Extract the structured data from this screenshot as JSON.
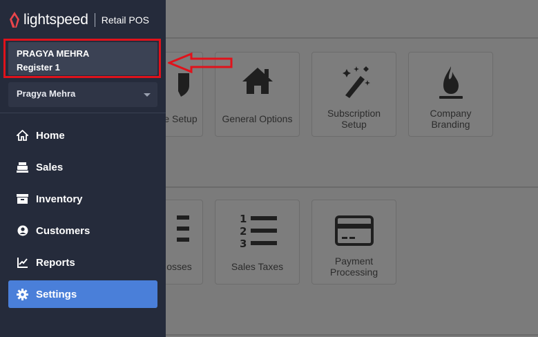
{
  "brand": {
    "logo_text": "lightspeed",
    "product": "Retail POS"
  },
  "sidebar": {
    "user_name_caps": "PRAGYA MEHRA",
    "register": "Register 1",
    "user_select": "Pragya Mehra",
    "nav": [
      {
        "label": "Home",
        "icon": "home-icon"
      },
      {
        "label": "Sales",
        "icon": "register-icon"
      },
      {
        "label": "Inventory",
        "icon": "box-icon"
      },
      {
        "label": "Customers",
        "icon": "user-circle-icon"
      },
      {
        "label": "Reports",
        "icon": "chart-line-icon"
      },
      {
        "label": "Settings",
        "icon": "gear-icon",
        "active": true
      }
    ]
  },
  "settings": {
    "row1": [
      {
        "label_line1": "e Setup",
        "label_line2": ""
      },
      {
        "label_line1": "General Options",
        "label_line2": ""
      },
      {
        "label_line1": "Subscription",
        "label_line2": "Setup"
      },
      {
        "label_line1": "Company",
        "label_line2": "Branding"
      }
    ],
    "row2": [
      {
        "label_line1": "osses",
        "label_line2": ""
      },
      {
        "label_line1": "Sales Taxes",
        "label_line2": ""
      },
      {
        "label_line1": "Payment",
        "label_line2": "Processing"
      }
    ]
  },
  "colors": {
    "sidebar_bg": "#252b3b",
    "active_nav": "#4a7fd9",
    "annotation_red": "#e0121b",
    "logo_red": "#e8454b"
  }
}
